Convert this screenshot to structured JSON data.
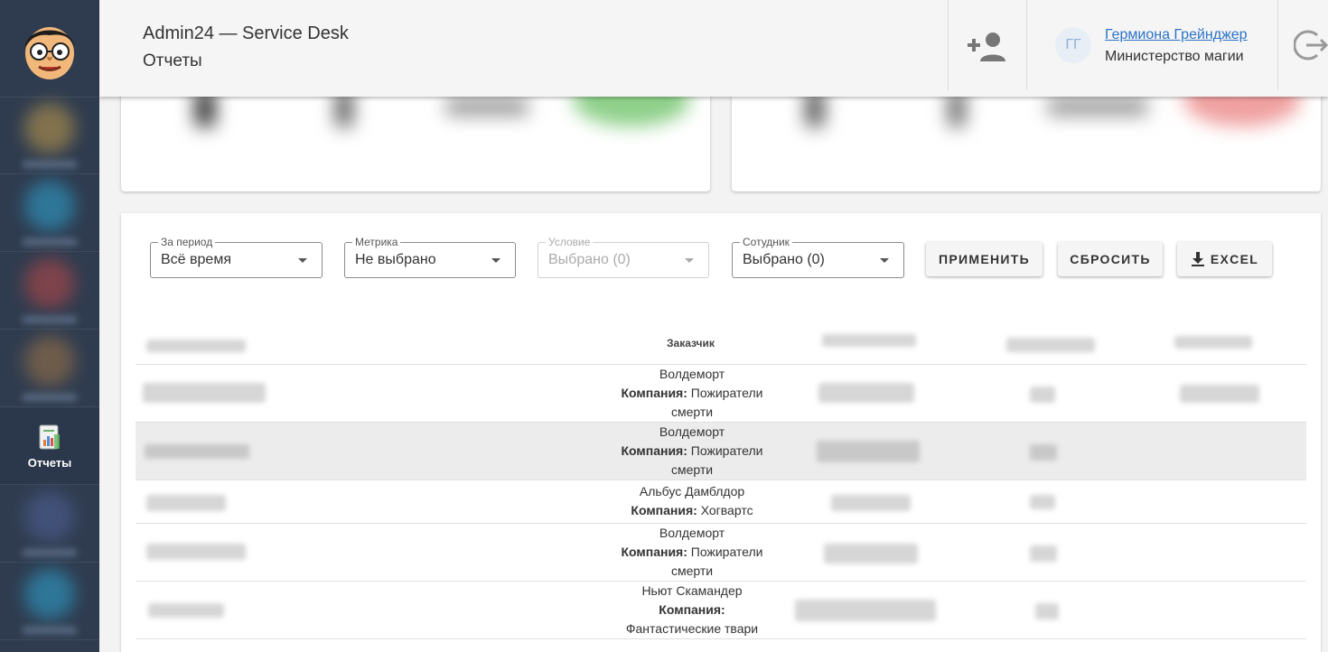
{
  "header": {
    "title": "Admin24 — Service Desk",
    "subtitle": "Отчеты",
    "user_initials": "ГГ",
    "user_name": "Гермиона Грейнджер",
    "user_org": "Министерство магии"
  },
  "sidebar": {
    "active_label": "Отчеты"
  },
  "filters": {
    "period": {
      "label": "За период",
      "value": "Всё время"
    },
    "metric": {
      "label": "Метрика",
      "value": "Не выбрано"
    },
    "condition": {
      "label": "Условие",
      "value": "Выбрано (0)"
    },
    "employee": {
      "label": "Сотудник",
      "value": "Выбрано (0)"
    }
  },
  "buttons": {
    "apply": "ПРИМЕНИТЬ",
    "reset": "СБРОСИТЬ",
    "excel": "EXCEL"
  },
  "table": {
    "customer_header": "Заказчик",
    "company_label": "Компания:",
    "rows": [
      {
        "name": "Волдеморт",
        "company": "Пожиратели",
        "company_rest": "смерти"
      },
      {
        "name": "Волдеморт",
        "company": "Пожиратели",
        "company_rest": "смерти"
      },
      {
        "name": "Альбус Дамблдор",
        "company": "Хогвартс",
        "company_rest": ""
      },
      {
        "name": "Волдеморт",
        "company": "Пожиратели",
        "company_rest": "смерти"
      },
      {
        "name": "Ньют Скамандер",
        "company": "",
        "company_rest": "Фантастические твари"
      }
    ]
  },
  "colors": {
    "sidebar": "#2f3c4f",
    "link": "#2a73c7",
    "highlight_row": "#ececec"
  }
}
